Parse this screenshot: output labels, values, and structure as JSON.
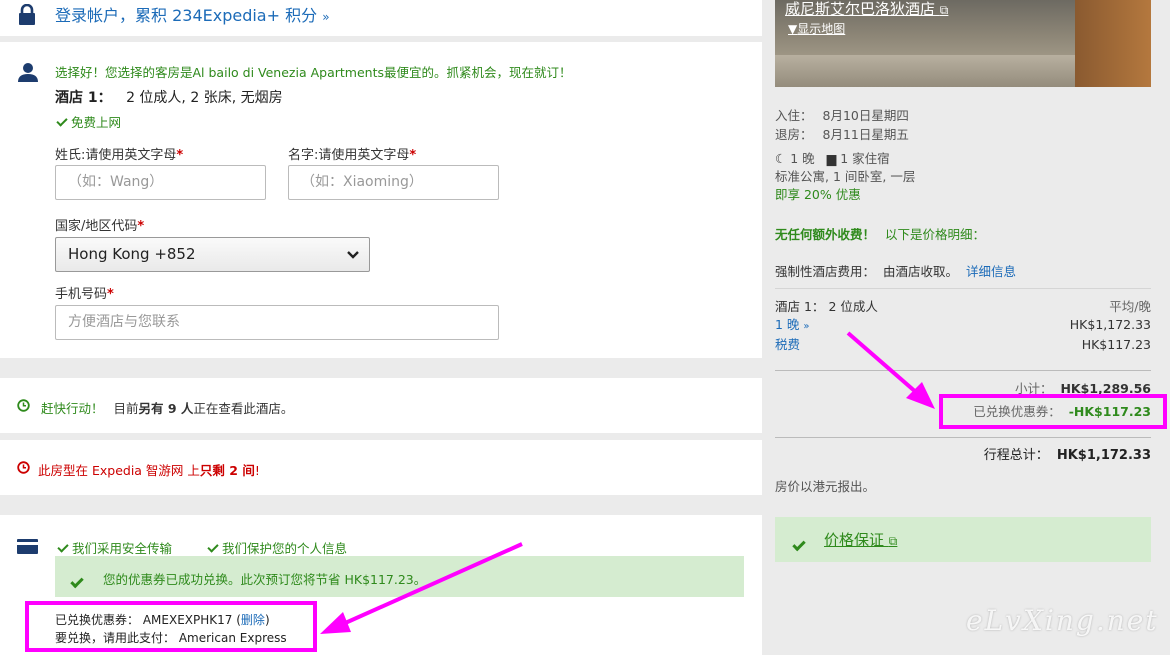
{
  "login": {
    "label": "登录帐户，累积 234Expedia+ 积分"
  },
  "traveler": {
    "promo_msg": "选择好！您选择的客房是Al bailo di Venezia Apartments最便宜的。抓紧机会，现在就订！",
    "room_label": "酒店 1：",
    "room_detail": "2 位成人, 2 张床, 无烟房",
    "wifi": "免费上网",
    "last_name_label": "姓氏:请使用英文字母",
    "last_name_placeholder": "（如：Wang）",
    "first_name_label": "名字:请使用英文字母",
    "first_name_placeholder": "（如：Xiaoming）",
    "country_label": "国家/地区代码",
    "country_value": "Hong Kong +852",
    "phone_label": "手机号码",
    "phone_placeholder": "方便酒店与您联系",
    "required_mark": "*"
  },
  "urgency": {
    "hurry": "赶快行动！",
    "viewing_prefix": "目前",
    "viewing_bold": "另有 9 人",
    "viewing_suffix": "正在查看此酒店。",
    "rooms_left_prefix": "此房型在 Expedia 智游网 上",
    "rooms_left_bold": "只剩 2 间",
    "rooms_left_suffix": "!"
  },
  "payment": {
    "secure": "我们采用安全传输",
    "privacy": "我们保护您的个人信息",
    "coupon_success": "您的优惠券已成功兑换。此次预订您将节省 HK$117.23。",
    "coupon_label": "已兑换优惠券：",
    "coupon_code": "AMEXEXPHK17",
    "coupon_delete": "删除",
    "pay_with_label": "要兑换，请用此支付：",
    "pay_with_value": "American Express"
  },
  "summary": {
    "hotel_name": "威尼斯艾尔巴洛狄酒店",
    "show_map": "显示地图",
    "checkin_label": "入住：",
    "checkin_value": "8月10日星期四",
    "checkout_label": "退房：",
    "checkout_value": "8月11日星期五",
    "nights": "1 晚",
    "hotels": "1 家住宿",
    "room_type": "标准公寓, 1 间卧室, 一层",
    "discount": "即享 20% 优惠",
    "no_extra_fee": "无任何额外收费！",
    "price_details": "以下是价格明细：",
    "mandatory_fee_label": "强制性酒店费用：",
    "mandatory_fee_value": "由酒店收取。",
    "details_link": "详细信息",
    "hotel_line": "酒店 1：",
    "hotel_line_guests": "2 位成人",
    "avg_per_night": "平均/晚",
    "nights_link": "1 晚",
    "nightly_price": "HK$1,172.33",
    "taxes_link": "税费",
    "taxes_value": "HK$117.23",
    "subtotal_label": "小计：",
    "subtotal_value": "HK$1,289.56",
    "coupon_applied_label": "已兑换优惠券：",
    "coupon_applied_value": "-HK$117.23",
    "total_label": "行程总计：",
    "total_value": "HK$1,172.33",
    "currency_note": "房价以港元报出。",
    "price_guarantee": "价格保证"
  },
  "watermark": "eLvXing.net",
  "colors": {
    "green": "#2f8a1c",
    "blue": "#1c6bb8",
    "red": "#cc0000",
    "magenta": "#ff00ff",
    "success_bg": "#d5ecd0"
  }
}
